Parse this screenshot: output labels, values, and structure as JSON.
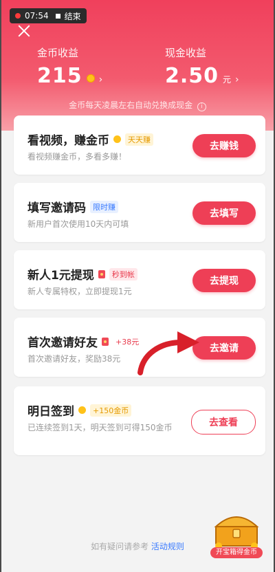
{
  "recording": {
    "time": "07:54",
    "stop_label": "结束"
  },
  "header": {
    "coin_label": "金币收益",
    "coin_value": "215",
    "cash_label": "现金收益",
    "cash_value": "2.50",
    "cash_unit": "元",
    "note": "金币每天凌晨左右自动兑换成现金",
    "info_icon": "i"
  },
  "tasks": [
    {
      "title": "看视频，赚金币",
      "badge": "天天赚",
      "desc": "看视频赚金币，多看多赚！",
      "button": "去赚钱"
    },
    {
      "title": "填写邀请码",
      "badge": "限时赚",
      "desc": "新用户首次使用10天内可填",
      "button": "去填写"
    },
    {
      "title": "新人1元提现",
      "badge": "秒到帐",
      "desc": "新人专属特权，立即提现1元",
      "button": "去提现"
    },
    {
      "title": "首次邀请好友",
      "badge": "+38元",
      "desc": "首次邀请好友，奖励38元",
      "button": "去邀请"
    },
    {
      "title": "明日签到",
      "badge": "+150金币",
      "desc": "已连续签到1天，明天签到可得150金币",
      "button": "去查看"
    }
  ],
  "footer": {
    "prefix": "如有疑问请参考",
    "link": "活动规则"
  },
  "chest": {
    "label": "开宝箱得金币"
  },
  "colors": {
    "accent": "#ee3f56",
    "header": "#f0405c"
  }
}
